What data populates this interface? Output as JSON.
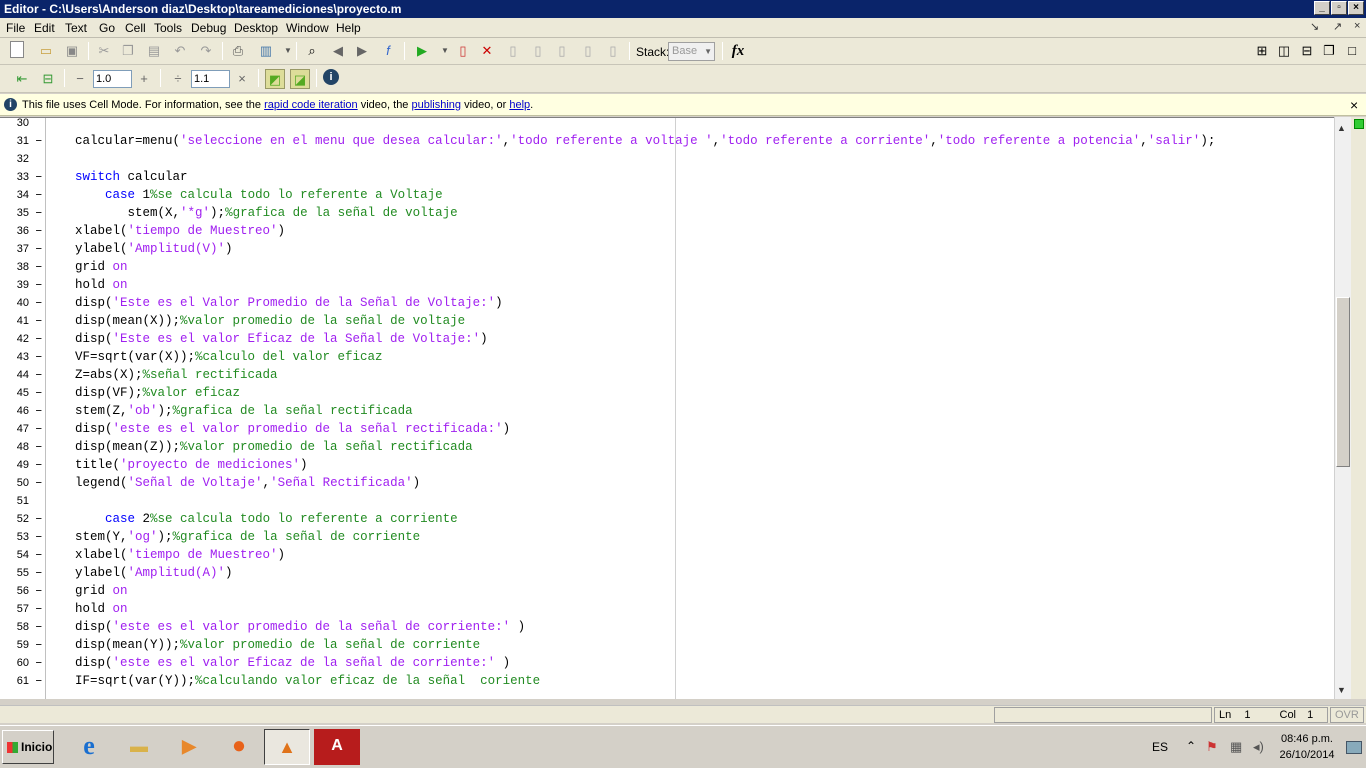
{
  "window": {
    "title": "Editor - C:\\Users\\Anderson diaz\\Desktop\\tareamediciones\\proyecto.m",
    "min": "_",
    "max": "▫",
    "close": "×"
  },
  "menu": [
    "File",
    "Edit",
    "Text",
    "Go",
    "Cell",
    "Tools",
    "Debug",
    "Desktop",
    "Window",
    "Help"
  ],
  "menu_right": [
    "↘",
    "↗",
    "×"
  ],
  "toolbar": {
    "stack_label": "Stack:",
    "stack_value": "Base",
    "fx_label": "fx"
  },
  "cell_toolbar": {
    "minus": "−",
    "plus": "+",
    "value1": "1.0",
    "divide": "÷",
    "value2": "1.1",
    "times": "×"
  },
  "infobar": {
    "text1": "This file uses Cell Mode. For information, see the ",
    "link1": "rapid code iteration",
    "text2": " video, the ",
    "link2": "publishing",
    "text3": " video, or ",
    "link3": "help",
    "text4": ".",
    "close": "×"
  },
  "code_lines": [
    {
      "n": "30",
      "dash": "",
      "segs": []
    },
    {
      "n": "31",
      "dash": "–",
      "segs": [
        [
          "n",
          "calcular=menu("
        ],
        [
          "s",
          "'seleccione en el menu que desea calcular:'"
        ],
        [
          "n",
          ","
        ],
        [
          "s",
          "'todo referente a voltaje '"
        ],
        [
          "n",
          ","
        ],
        [
          "s",
          "'todo referente a corriente'"
        ],
        [
          "n",
          ","
        ],
        [
          "s",
          "'todo referente a potencia'"
        ],
        [
          "n",
          ","
        ],
        [
          "s",
          "'salir'"
        ],
        [
          "n",
          ");"
        ]
      ]
    },
    {
      "n": "32",
      "dash": "",
      "segs": []
    },
    {
      "n": "33",
      "dash": "–",
      "segs": [
        [
          "k",
          "switch"
        ],
        [
          "n",
          " calcular"
        ]
      ]
    },
    {
      "n": "34",
      "dash": "–",
      "segs": [
        [
          "n",
          "    "
        ],
        [
          "k",
          "case"
        ],
        [
          "n",
          " 1"
        ],
        [
          "c",
          "%se calcula todo lo referente a Voltaje"
        ]
      ]
    },
    {
      "n": "35",
      "dash": "–",
      "segs": [
        [
          "n",
          "       stem(X,"
        ],
        [
          "s",
          "'*g'"
        ],
        [
          "n",
          ");"
        ],
        [
          "c",
          "%grafica de la señal de voltaje"
        ]
      ]
    },
    {
      "n": "36",
      "dash": "–",
      "segs": [
        [
          "n",
          "xlabel("
        ],
        [
          "s",
          "'tiempo de Muestreo'"
        ],
        [
          "n",
          ")"
        ]
      ]
    },
    {
      "n": "37",
      "dash": "–",
      "segs": [
        [
          "n",
          "ylabel("
        ],
        [
          "s",
          "'Amplitud(V)'"
        ],
        [
          "n",
          ")"
        ]
      ]
    },
    {
      "n": "38",
      "dash": "–",
      "segs": [
        [
          "n",
          "grid "
        ],
        [
          "s",
          "on"
        ]
      ]
    },
    {
      "n": "39",
      "dash": "–",
      "segs": [
        [
          "n",
          "hold "
        ],
        [
          "s",
          "on"
        ]
      ]
    },
    {
      "n": "40",
      "dash": "–",
      "segs": [
        [
          "n",
          "disp("
        ],
        [
          "s",
          "'Este es el Valor Promedio de la Señal de Voltaje:'"
        ],
        [
          "n",
          ")"
        ]
      ]
    },
    {
      "n": "41",
      "dash": "–",
      "segs": [
        [
          "n",
          "disp(mean(X));"
        ],
        [
          "c",
          "%valor promedio de la señal de voltaje"
        ]
      ]
    },
    {
      "n": "42",
      "dash": "–",
      "segs": [
        [
          "n",
          "disp("
        ],
        [
          "s",
          "'Este es el valor Eficaz de la Señal de Voltaje:'"
        ],
        [
          "n",
          ")"
        ]
      ]
    },
    {
      "n": "43",
      "dash": "–",
      "segs": [
        [
          "n",
          "VF=sqrt(var(X));"
        ],
        [
          "c",
          "%calculo del valor eficaz"
        ]
      ]
    },
    {
      "n": "44",
      "dash": "–",
      "segs": [
        [
          "n",
          "Z=abs(X);"
        ],
        [
          "c",
          "%señal rectificada"
        ]
      ]
    },
    {
      "n": "45",
      "dash": "–",
      "segs": [
        [
          "n",
          "disp(VF);"
        ],
        [
          "c",
          "%valor eficaz"
        ]
      ]
    },
    {
      "n": "46",
      "dash": "–",
      "segs": [
        [
          "n",
          "stem(Z,"
        ],
        [
          "s",
          "'ob'"
        ],
        [
          "n",
          ");"
        ],
        [
          "c",
          "%grafica de la señal rectificada"
        ]
      ]
    },
    {
      "n": "47",
      "dash": "–",
      "segs": [
        [
          "n",
          "disp("
        ],
        [
          "s",
          "'este es el valor promedio de la señal rectificada:'"
        ],
        [
          "n",
          ")"
        ]
      ]
    },
    {
      "n": "48",
      "dash": "–",
      "segs": [
        [
          "n",
          "disp(mean(Z));"
        ],
        [
          "c",
          "%valor promedio de la señal rectificada"
        ]
      ]
    },
    {
      "n": "49",
      "dash": "–",
      "segs": [
        [
          "n",
          "title("
        ],
        [
          "s",
          "'proyecto de mediciones'"
        ],
        [
          "n",
          ")"
        ]
      ]
    },
    {
      "n": "50",
      "dash": "–",
      "segs": [
        [
          "n",
          "legend("
        ],
        [
          "s",
          "'Señal de Voltaje'"
        ],
        [
          "n",
          ","
        ],
        [
          "s",
          "'Señal Rectificada'"
        ],
        [
          "n",
          ")"
        ]
      ]
    },
    {
      "n": "51",
      "dash": "",
      "segs": []
    },
    {
      "n": "52",
      "dash": "–",
      "segs": [
        [
          "n",
          "    "
        ],
        [
          "k",
          "case"
        ],
        [
          "n",
          " 2"
        ],
        [
          "c",
          "%se calcula todo lo referente a corriente"
        ]
      ]
    },
    {
      "n": "53",
      "dash": "–",
      "segs": [
        [
          "n",
          "stem(Y,"
        ],
        [
          "s",
          "'og'"
        ],
        [
          "n",
          ");"
        ],
        [
          "c",
          "%grafica de la señal de corriente"
        ]
      ]
    },
    {
      "n": "54",
      "dash": "–",
      "segs": [
        [
          "n",
          "xlabel("
        ],
        [
          "s",
          "'tiempo de Muestreo'"
        ],
        [
          "n",
          ")"
        ]
      ]
    },
    {
      "n": "55",
      "dash": "–",
      "segs": [
        [
          "n",
          "ylabel("
        ],
        [
          "s",
          "'Amplitud(A)'"
        ],
        [
          "n",
          ")"
        ]
      ]
    },
    {
      "n": "56",
      "dash": "–",
      "segs": [
        [
          "n",
          "grid "
        ],
        [
          "s",
          "on"
        ]
      ]
    },
    {
      "n": "57",
      "dash": "–",
      "segs": [
        [
          "n",
          "hold "
        ],
        [
          "s",
          "on"
        ]
      ]
    },
    {
      "n": "58",
      "dash": "–",
      "segs": [
        [
          "n",
          "disp("
        ],
        [
          "s",
          "'este es el valor promedio de la señal de corriente:'"
        ],
        [
          "n",
          " )"
        ]
      ]
    },
    {
      "n": "59",
      "dash": "–",
      "segs": [
        [
          "n",
          "disp(mean(Y));"
        ],
        [
          "c",
          "%valor promedio de la señal de corriente"
        ]
      ]
    },
    {
      "n": "60",
      "dash": "–",
      "segs": [
        [
          "n",
          "disp("
        ],
        [
          "s",
          "'este es el valor Eficaz de la señal de corriente:'"
        ],
        [
          "n",
          " )"
        ]
      ]
    },
    {
      "n": "61",
      "dash": "–",
      "segs": [
        [
          "n",
          "IF=sqrt(var(Y));"
        ],
        [
          "c",
          "%calculando valor eficaz de la señal  coriente"
        ]
      ]
    }
  ],
  "status": {
    "ln_label": "Ln",
    "ln_value": "1",
    "col_label": "Col",
    "col_value": "1",
    "ovr": "OVR"
  },
  "taskbar": {
    "start": "Inicio",
    "lang": "ES",
    "time": "08:46 p.m.",
    "date": "26/10/2014"
  },
  "colors": {
    "keyword": "#0000ff",
    "string": "#a020f0",
    "comment": "#228b22",
    "titlebar": "#0a246a"
  }
}
